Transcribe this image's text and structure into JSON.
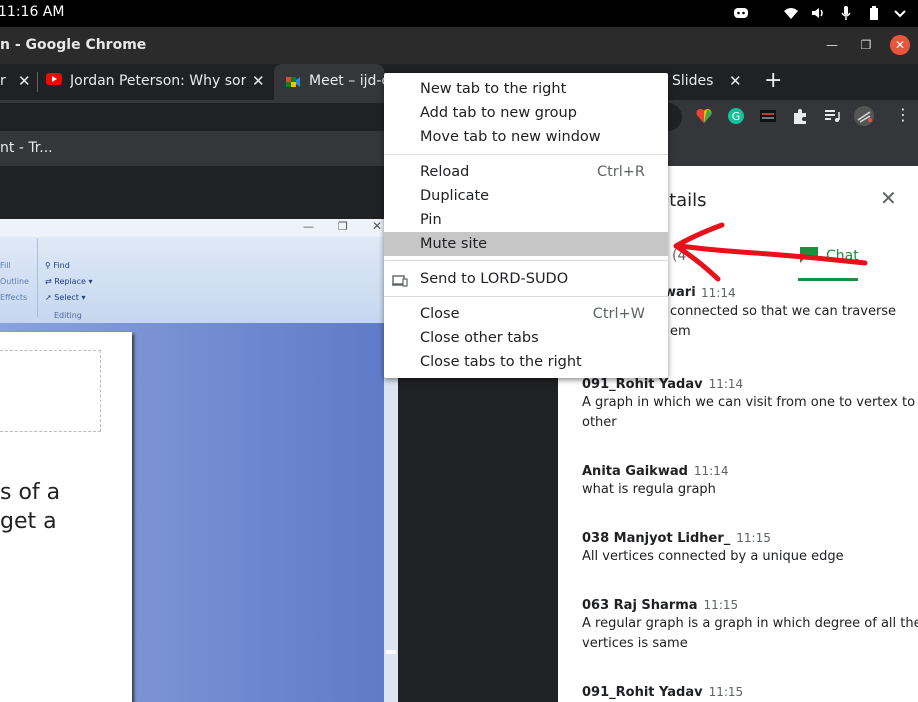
{
  "system_bar": {
    "clock": "11:16 AM"
  },
  "window": {
    "title": "n - Google Chrome"
  },
  "tabs": [
    {
      "label": "r"
    },
    {
      "label": "Jordan Peterson: Why sor"
    },
    {
      "label": "Meet – ijd-c"
    },
    {
      "label": "Slides"
    }
  ],
  "bookmarks": {
    "item1": "nt - Tr..."
  },
  "ppt": {
    "find": "Find",
    "replace": "Replace",
    "select": "Select",
    "editing": "Editing",
    "fill": "Fill",
    "outline": "Outline",
    "effects": "Effects",
    "slide_line1": "s of a",
    "slide_line2": "get a"
  },
  "context_menu": {
    "new_tab_right": "New tab to the right",
    "add_to_group": "Add tab to new group",
    "move_to_window": "Move tab to new window",
    "reload": "Reload",
    "reload_shortcut": "Ctrl+R",
    "duplicate": "Duplicate",
    "pin": "Pin",
    "mute_site": "Mute site",
    "send_to": "Send to LORD-SUDO",
    "close": "Close",
    "close_shortcut": "Ctrl+W",
    "close_other": "Close other tabs",
    "close_right": "Close tabs to the right"
  },
  "meet": {
    "panel_title": "etails",
    "people_count": "(4",
    "chat_tab": "Chat",
    "messages": [
      {
        "name": "wari",
        "time": "11:14",
        "text1": "connected so that we can traverse",
        "text2": "em"
      },
      {
        "name": "091_Rohit Yadav",
        "time": "11:14",
        "text1": "A graph in which we can visit from one to vertex to",
        "text2": "other"
      },
      {
        "name": "Anita Gaikwad",
        "time": "11:14",
        "text1": "what is regula graph",
        "text2": ""
      },
      {
        "name": "038 Manjyot Lidher_",
        "time": "11:15",
        "text1": "All vertices connected by a unique edge",
        "text2": ""
      },
      {
        "name": "063 Raj Sharma",
        "time": "11:15",
        "text1": "A regular graph is a graph in which degree of all the",
        "text2": "vertices is same"
      },
      {
        "name": "091_Rohit Yadav",
        "time": "11:15",
        "text1": "",
        "text2": ""
      }
    ]
  },
  "colors": {
    "accent_green": "#1e8e3e",
    "annotation_red": "#e8101a",
    "close_red": "#e8553d"
  }
}
